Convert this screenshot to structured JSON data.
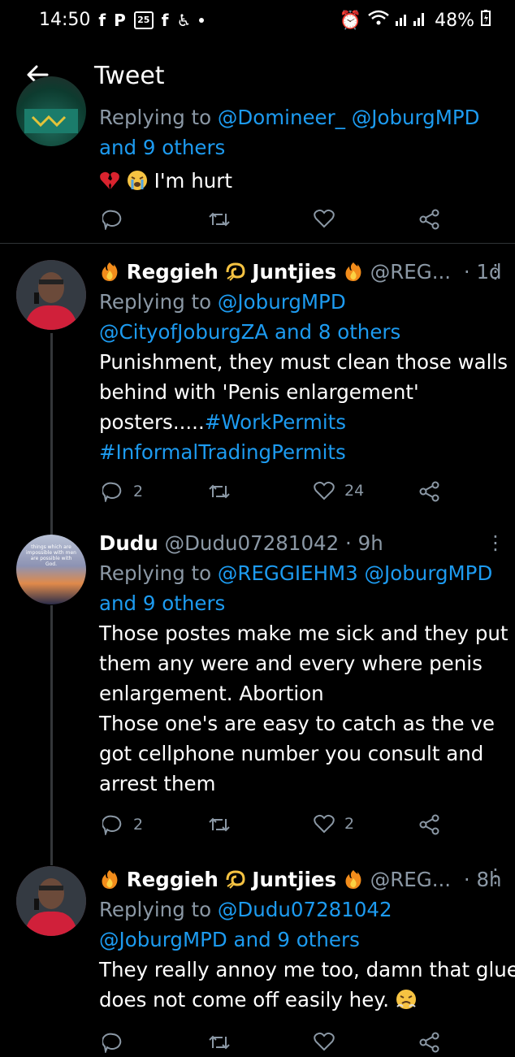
{
  "status": {
    "time": "14:50",
    "calendar": "25",
    "battery": "48%"
  },
  "header": {
    "title": "Tweet"
  },
  "tweets": [
    {
      "replying_prefix": "Replying to",
      "replying": "@Domineer_ @JoburgMPD",
      "replying_line2": "and 9 others",
      "text": "I'm hurt"
    },
    {
      "name_a": "Reggieh",
      "name_b": "Juntjies",
      "handle": "@REG...",
      "time": "· 1d",
      "replying_prefix": "Replying to",
      "replying": "@JoburgMPD",
      "replying_line2": "@CityofJoburgZA and 8 others",
      "text_lines": [
        "Punishment, they must clean those walls",
        "behind with 'Penis enlargement'",
        "posters.....",
        "#InformalTradingPermits"
      ],
      "hashtag1": "#WorkPermits",
      "replies": "2",
      "likes": "24"
    },
    {
      "name": "Dudu",
      "handle": "@Dudu07281042",
      "time": "· 9h",
      "replying_prefix": "Replying to",
      "replying": "@REGGIEHM3 @JoburgMPD",
      "replying_line2": "and 9 others",
      "text_lines": [
        "Those postes make me sick and they put",
        "them any were and every where penis",
        "enlargement. Abortion",
        "Those one's are easy to catch as the ve",
        "got cellphone number you consult and",
        "arrest them"
      ],
      "replies": "2",
      "likes": "2",
      "avatar_text": "things which are impossible with men are possible with God."
    },
    {
      "name_a": "Reggieh",
      "name_b": "Juntjies",
      "handle": "@REG...",
      "time": "· 8h",
      "replying_prefix": "Replying to",
      "replying": "@Dudu07281042",
      "replying_line2": "@JoburgMPD and 9 others",
      "text_lines": [
        "They really annoy me too, damn that glue",
        "does not come off easily hey."
      ]
    }
  ],
  "colors": {
    "accent": "#1d9bf0",
    "muted": "#8b98a5",
    "background": "#000000"
  }
}
